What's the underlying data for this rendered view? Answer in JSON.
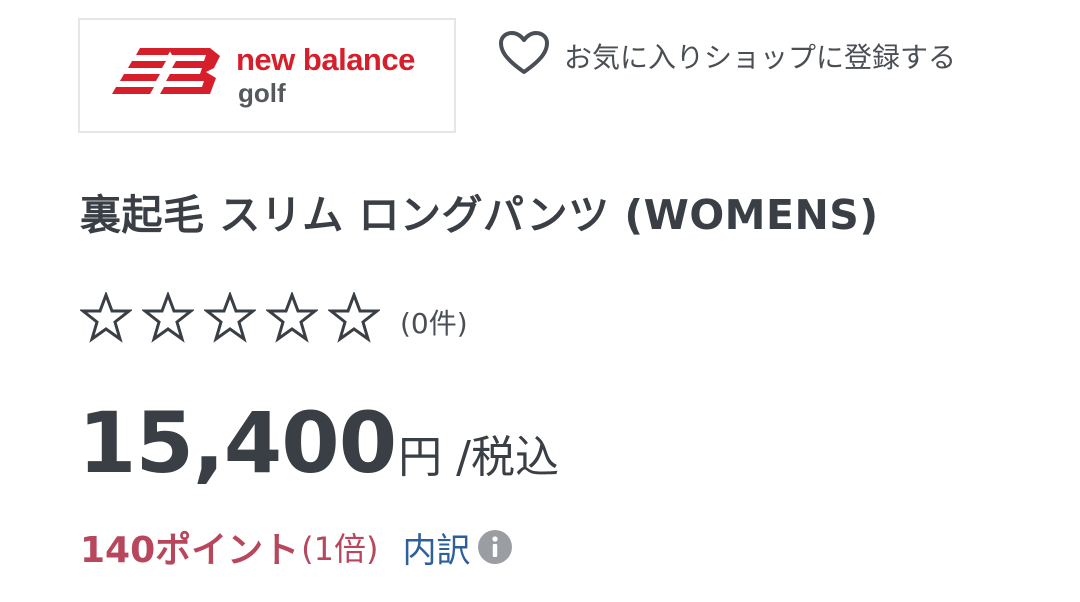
{
  "brand": {
    "logo_line1": "new balance",
    "logo_line2": "golf",
    "logo_color": "#d71f2b"
  },
  "favorite": {
    "label": "お気に入りショップに登録する",
    "icon": "heart-outline-icon"
  },
  "product": {
    "title": "裏起毛 スリム ロングパンツ (WOMENS)"
  },
  "rating": {
    "stars_filled": 0,
    "stars_total": 5,
    "count_text": "(0件)",
    "icon": "star-outline-icon"
  },
  "price": {
    "value": "15,400",
    "unit": "円",
    "tax_label": "/税込"
  },
  "points": {
    "value_text": "140ポイント",
    "multiplier_text": "(1倍)",
    "breakdown_label": "内訳",
    "color": "#b8465c",
    "link_color": "#2d5f9a"
  }
}
